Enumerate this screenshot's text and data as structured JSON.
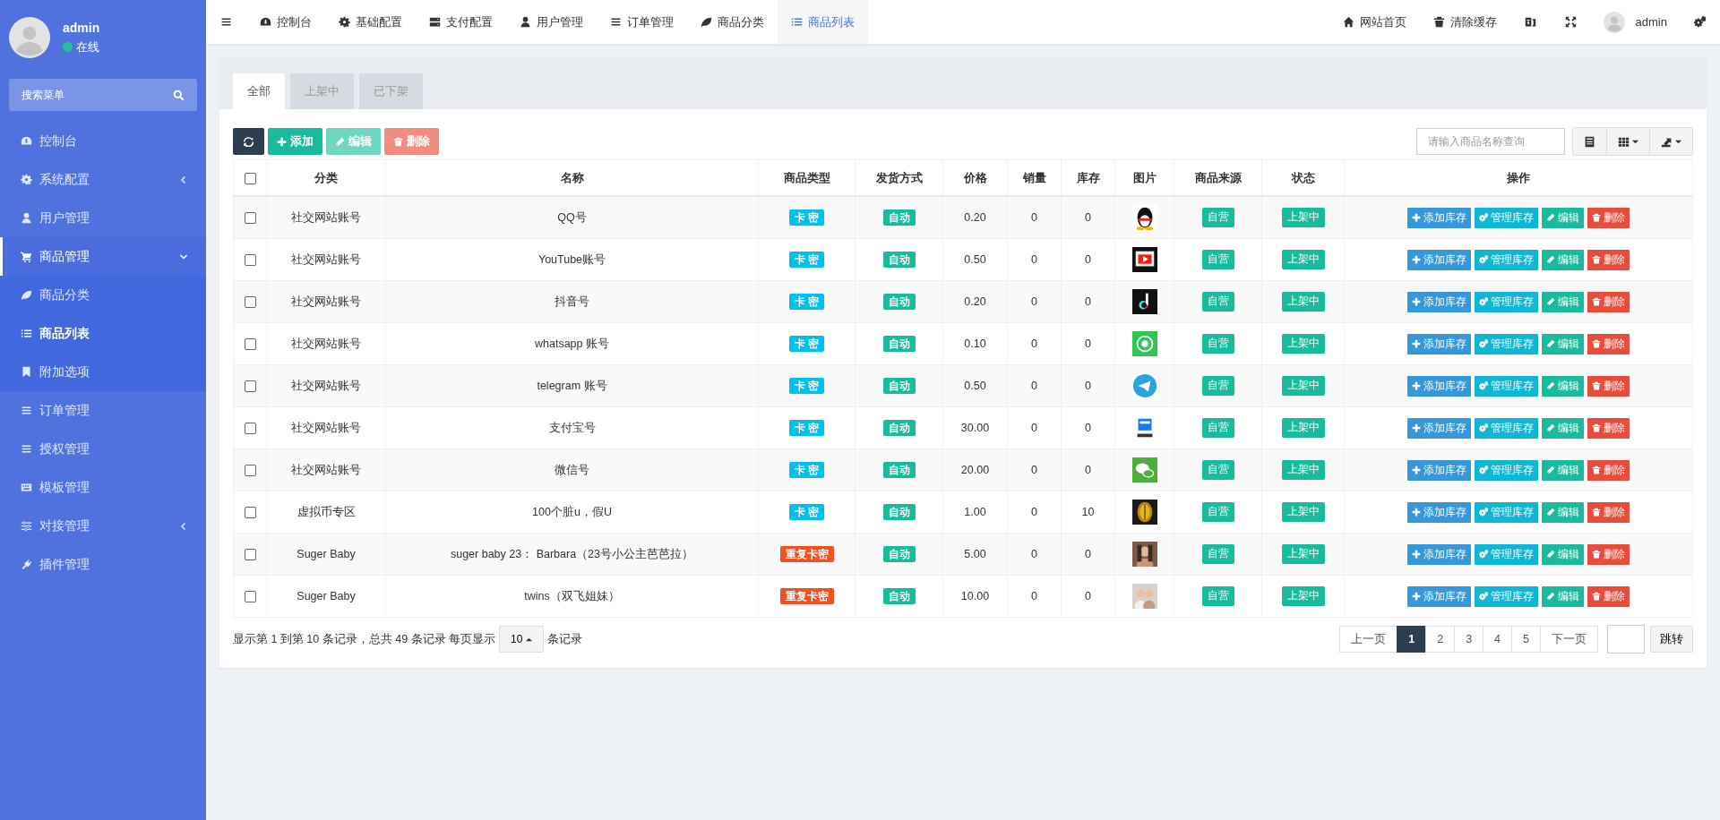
{
  "user_panel": {
    "name": "admin",
    "status": "在线"
  },
  "sidebar": {
    "search": {
      "placeholder": "搜索菜单"
    },
    "items": [
      {
        "label": "控制台",
        "selected": false
      },
      {
        "label": "系统配置",
        "selected": false,
        "expanded": false
      },
      {
        "label": "用户管理",
        "selected": false
      },
      {
        "label": "商品管理",
        "selected": false,
        "expanded": true,
        "children": [
          {
            "label": "商品分类",
            "selected": false
          },
          {
            "label": "商品列表",
            "selected": true
          },
          {
            "label": "附加选项",
            "selected": false
          }
        ]
      },
      {
        "label": "订单管理",
        "selected": false
      },
      {
        "label": "授权管理",
        "selected": false
      },
      {
        "label": "模板管理",
        "selected": false
      },
      {
        "label": "对接管理",
        "selected": false,
        "expanded": false
      },
      {
        "label": "插件管理",
        "selected": false
      }
    ]
  },
  "top_tabs": [
    {
      "label": "控制台",
      "selected": false
    },
    {
      "label": "基础配置",
      "selected": false
    },
    {
      "label": "支付配置",
      "selected": false
    },
    {
      "label": "用户管理",
      "selected": false
    },
    {
      "label": "订单管理",
      "selected": false
    },
    {
      "label": "商品分类",
      "selected": false
    },
    {
      "label": "商品列表",
      "selected": true
    }
  ],
  "top_right": {
    "links": [
      "网站首页",
      "清除缓存"
    ],
    "user": "admin"
  },
  "filter_tabs": [
    {
      "label": "全部",
      "selected": true
    },
    {
      "label": "上架中",
      "selected": false
    },
    {
      "label": "已下架",
      "selected": false
    }
  ],
  "toolbar": {
    "buttons": [
      {
        "label": "添加",
        "disabled": false
      },
      {
        "label": "编辑",
        "disabled": true
      },
      {
        "label": "删除",
        "disabled": true
      }
    ],
    "search": {
      "placeholder": "请输入商品名称查询"
    }
  },
  "table": {
    "select_all_checked": false,
    "columns": [
      "分类",
      "名称",
      "商品类型",
      "发货方式",
      "价格",
      "销量",
      "库存",
      "图片",
      "商品来源",
      "状态",
      "操作"
    ],
    "rows": [
      {
        "checked": false,
        "category": "社交网站账号",
        "name": "QQ号",
        "type": {
          "label": "卡 密",
          "color": "#00c0ef"
        },
        "delivery": "自动",
        "price": "0.20",
        "sales": "0",
        "stock": "0",
        "source": "自营",
        "status": "上架中",
        "actions": [
          "添加库存",
          "管理库存",
          "编辑",
          "删除"
        ]
      },
      {
        "checked": false,
        "category": "社交网站账号",
        "name": "YouTube账号",
        "type": {
          "label": "卡 密",
          "color": "#00c0ef"
        },
        "delivery": "自动",
        "price": "0.50",
        "sales": "0",
        "stock": "0",
        "source": "自营",
        "status": "上架中",
        "actions": [
          "添加库存",
          "管理库存",
          "编辑",
          "删除"
        ]
      },
      {
        "checked": false,
        "category": "社交网站账号",
        "name": "抖音号",
        "type": {
          "label": "卡 密",
          "color": "#00c0ef"
        },
        "delivery": "自动",
        "price": "0.20",
        "sales": "0",
        "stock": "0",
        "source": "自营",
        "status": "上架中",
        "actions": [
          "添加库存",
          "管理库存",
          "编辑",
          "删除"
        ]
      },
      {
        "checked": false,
        "category": "社交网站账号",
        "name": "whatsapp 账号",
        "type": {
          "label": "卡 密",
          "color": "#00c0ef"
        },
        "delivery": "自动",
        "price": "0.10",
        "sales": "0",
        "stock": "0",
        "source": "自营",
        "status": "上架中",
        "actions": [
          "添加库存",
          "管理库存",
          "编辑",
          "删除"
        ]
      },
      {
        "checked": false,
        "category": "社交网站账号",
        "name": "telegram 账号",
        "type": {
          "label": "卡 密",
          "color": "#00c0ef"
        },
        "delivery": "自动",
        "price": "0.50",
        "sales": "0",
        "stock": "0",
        "source": "自营",
        "status": "上架中",
        "actions": [
          "添加库存",
          "管理库存",
          "编辑",
          "删除"
        ]
      },
      {
        "checked": false,
        "category": "社交网站账号",
        "name": "支付宝号",
        "type": {
          "label": "卡 密",
          "color": "#00c0ef"
        },
        "delivery": "自动",
        "price": "30.00",
        "sales": "0",
        "stock": "0",
        "source": "自营",
        "status": "上架中",
        "actions": [
          "添加库存",
          "管理库存",
          "编辑",
          "删除"
        ]
      },
      {
        "checked": false,
        "category": "社交网站账号",
        "name": "微信号",
        "type": {
          "label": "卡 密",
          "color": "#00c0ef"
        },
        "delivery": "自动",
        "price": "20.00",
        "sales": "0",
        "stock": "0",
        "source": "自营",
        "status": "上架中",
        "actions": [
          "添加库存",
          "管理库存",
          "编辑",
          "删除"
        ]
      },
      {
        "checked": false,
        "category": "虚拟币专区",
        "name": "100个脏u，假U",
        "type": {
          "label": "卡 密",
          "color": "#00c0ef"
        },
        "delivery": "自动",
        "price": "1.00",
        "sales": "0",
        "stock": "10",
        "source": "自营",
        "status": "上架中",
        "actions": [
          "添加库存",
          "管理库存",
          "编辑",
          "删除"
        ]
      },
      {
        "checked": false,
        "category": "Suger Baby",
        "name": "suger baby 23： Barbara（23号小公主芭芭拉）",
        "type": {
          "label": "重复卡密",
          "color": "#f4511e"
        },
        "delivery": "自动",
        "price": "5.00",
        "sales": "0",
        "stock": "0",
        "source": "自营",
        "status": "上架中",
        "actions": [
          "添加库存",
          "管理库存",
          "编辑",
          "删除"
        ]
      },
      {
        "checked": false,
        "category": "Suger Baby",
        "name": "twins（双飞姐妹）",
        "type": {
          "label": "重复卡密",
          "color": "#f4511e"
        },
        "delivery": "自动",
        "price": "10.00",
        "sales": "0",
        "stock": "0",
        "source": "自营",
        "status": "上架中",
        "actions": [
          "添加库存",
          "管理库存",
          "编辑",
          "删除"
        ]
      }
    ]
  },
  "pagination": {
    "info": "显示第 1 到第 10 条记录，总共 49 条记录 每页显示",
    "page_size": "10",
    "info_suffix": "条记录",
    "prev": "上一页",
    "pages": [
      {
        "label": "1",
        "selected": true
      },
      {
        "label": "2",
        "selected": false
      },
      {
        "label": "3",
        "selected": false
      },
      {
        "label": "4",
        "selected": false
      },
      {
        "label": "5",
        "selected": false
      }
    ],
    "next": "下一页",
    "jump": "跳转"
  }
}
